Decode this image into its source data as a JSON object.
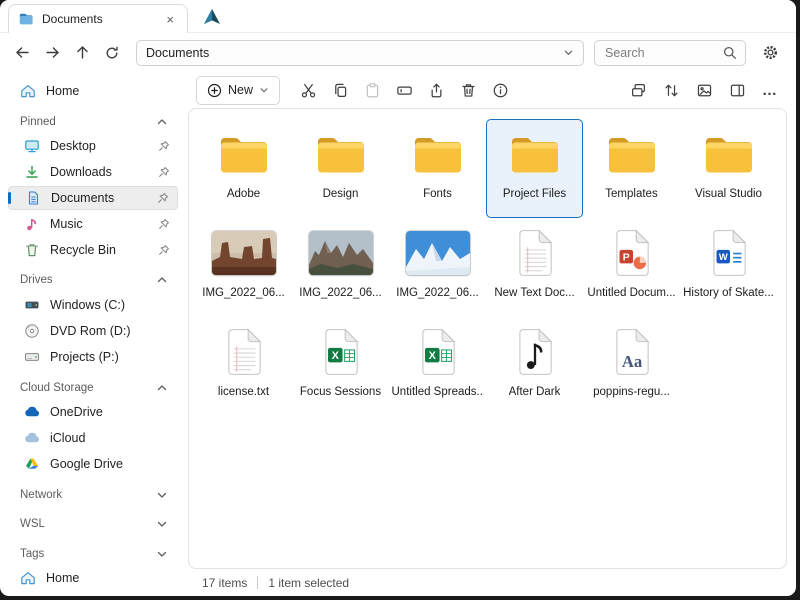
{
  "window": {
    "tab_title": "Documents",
    "nav": {
      "address": "Documents",
      "search_placeholder": "Search"
    }
  },
  "glyphs": {
    "tab_close": "×",
    "more_options": "…"
  },
  "sidebar": {
    "home_label": "Home",
    "bottom_home_label": "Home",
    "sections": {
      "pinned": {
        "label": "Pinned",
        "items": [
          {
            "label": "Desktop"
          },
          {
            "label": "Downloads"
          },
          {
            "label": "Documents"
          },
          {
            "label": "Music"
          },
          {
            "label": "Recycle Bin"
          }
        ]
      },
      "drives": {
        "label": "Drives",
        "items": [
          {
            "label": "Windows (C:)"
          },
          {
            "label": "DVD Rom (D:)"
          },
          {
            "label": "Projects (P:)"
          }
        ]
      },
      "cloud": {
        "label": "Cloud Storage",
        "items": [
          {
            "label": "OneDrive"
          },
          {
            "label": "iCloud"
          },
          {
            "label": "Google Drive"
          }
        ]
      },
      "network": {
        "label": "Network"
      },
      "wsl": {
        "label": "WSL"
      },
      "tags": {
        "label": "Tags"
      }
    }
  },
  "toolbar": {
    "new_label": "New"
  },
  "files": {
    "items": [
      {
        "name": "Adobe",
        "type": "folder"
      },
      {
        "name": "Design",
        "type": "folder"
      },
      {
        "name": "Fonts",
        "type": "folder"
      },
      {
        "name": "Project Files",
        "type": "folder",
        "selected": true
      },
      {
        "name": "Templates",
        "type": "folder"
      },
      {
        "name": "Visual Studio",
        "type": "folder"
      },
      {
        "name": "IMG_2022_06...",
        "type": "image"
      },
      {
        "name": "IMG_2022_06...",
        "type": "image"
      },
      {
        "name": "IMG_2022_06...",
        "type": "image"
      },
      {
        "name": "New Text Doc...",
        "type": "text"
      },
      {
        "name": "Untitled Docum...",
        "type": "powerpoint"
      },
      {
        "name": "History of Skate...",
        "type": "word"
      },
      {
        "name": "license.txt",
        "type": "text"
      },
      {
        "name": "Focus Sessions",
        "type": "excel"
      },
      {
        "name": "Untitled Spreads...",
        "type": "excel"
      },
      {
        "name": "After Dark",
        "type": "audio"
      },
      {
        "name": "poppins-regu...",
        "type": "font"
      }
    ]
  },
  "statusbar": {
    "count": "17 items",
    "selection": "1 item selected"
  }
}
